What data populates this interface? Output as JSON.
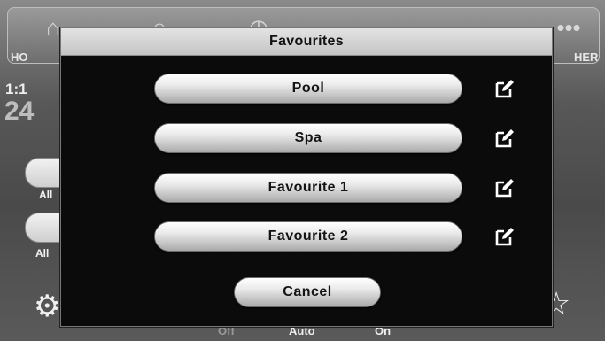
{
  "background": {
    "tabs": [
      {
        "label": "HO",
        "icon": "home-icon"
      },
      {
        "label": "",
        "icon": "light-icon"
      },
      {
        "label": "",
        "icon": "timer-icon"
      },
      {
        "label": "",
        "icon": "flame-icon"
      },
      {
        "label": "",
        "icon": "sun-icon"
      },
      {
        "label": "HER",
        "icon": "more-icon"
      }
    ],
    "time": "1:1",
    "temperature": "24",
    "pill_labels": [
      "All",
      "All"
    ],
    "mode_labels": [
      "Off",
      "Auto",
      "On"
    ]
  },
  "modal": {
    "title": "Favourites",
    "favourites": [
      {
        "label": "Pool"
      },
      {
        "label": "Spa"
      },
      {
        "label": "Favourite 1"
      },
      {
        "label": "Favourite 2"
      }
    ],
    "cancel_label": "Cancel"
  },
  "colors": {
    "modal_background": "#0b0b0b",
    "header_background": "#d4d4d4",
    "button_face": "#e0e0e0"
  }
}
